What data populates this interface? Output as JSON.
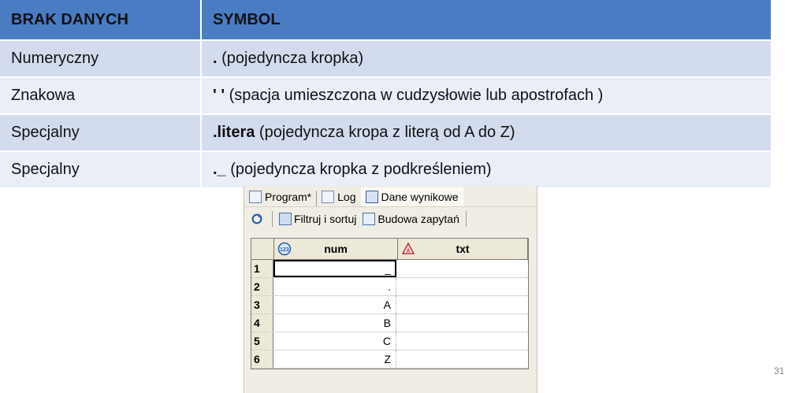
{
  "table": {
    "headers": [
      "BRAK DANYCH",
      "SYMBOL"
    ],
    "rows": [
      {
        "type": "Numeryczny",
        "symbol_bold": ".",
        "symbol_rest": " (pojedyncza kropka)"
      },
      {
        "type": "Znakowa",
        "symbol_bold": "' '",
        "symbol_rest": " (spacja umieszczona w cudzysłowie lub apostrofach )"
      },
      {
        "type": "Specjalny",
        "symbol_bold": ".litera",
        "symbol_rest": " (pojedyncza kropa z literą od A do Z)"
      },
      {
        "type": "Specjalny",
        "symbol_bold": "._",
        "symbol_rest": " (pojedyncza kropka z podkreśleniem)"
      }
    ]
  },
  "window": {
    "tabs": [
      "Program*",
      "Log",
      "Dane wynikowe"
    ],
    "toolbar": {
      "filter_label": "Filtruj i sortuj",
      "query_label": "Budowa zapytań"
    },
    "grid": {
      "columns": [
        "num",
        "txt"
      ],
      "rows": [
        {
          "n": "1",
          "num": "_",
          "txt": ""
        },
        {
          "n": "2",
          "num": ".",
          "txt": ""
        },
        {
          "n": "3",
          "num": "A",
          "txt": ""
        },
        {
          "n": "4",
          "num": "B",
          "txt": ""
        },
        {
          "n": "5",
          "num": "C",
          "txt": ""
        },
        {
          "n": "6",
          "num": "Z",
          "txt": ""
        }
      ]
    }
  },
  "page_number": "31",
  "colors": {
    "header_bg": "#4a7cc4",
    "row_dark": "#d3dcee",
    "row_light": "#e9eef7"
  }
}
